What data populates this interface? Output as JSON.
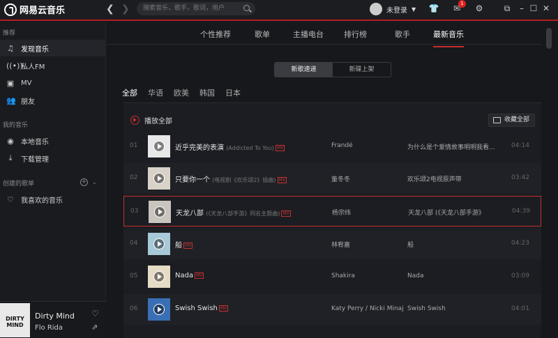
{
  "app": {
    "title": "网易云音乐"
  },
  "search": {
    "placeholder": "搜索音乐，歌手，歌词，用户"
  },
  "user": {
    "label": "未登录",
    "notifications": "1"
  },
  "sidebar": {
    "sections": [
      "推荐",
      "我的音乐",
      "创建的歌单"
    ],
    "items": [
      {
        "label": "发现音乐"
      },
      {
        "label": "私人FM"
      },
      {
        "label": "MV"
      },
      {
        "label": "朋友"
      },
      {
        "label": "本地音乐"
      },
      {
        "label": "下载管理"
      },
      {
        "label": "我喜欢的音乐"
      }
    ]
  },
  "now_playing": {
    "cover_text": "DIRTY MIND",
    "title": "Dirty Mind",
    "artist": "Flo Rida"
  },
  "tabs": [
    "个性推荐",
    "歌单",
    "主播电台",
    "排行榜",
    "歌手",
    "最新音乐"
  ],
  "segment": [
    "新歌速递",
    "新碟上架"
  ],
  "regions": [
    "全部",
    "华语",
    "欧美",
    "韩国",
    "日本"
  ],
  "list": {
    "play_all": "播放全部",
    "collect_all": "收藏全部",
    "songs": [
      {
        "num": "01",
        "title": "近乎完美的表演",
        "sub": "(Addicted To You)",
        "artist": "Frandé",
        "album": "为什么是个爱情故事明明我看...",
        "dur": "04:14"
      },
      {
        "num": "02",
        "title": "只要你一个",
        "sub": "(电视剧《欢乐颂2》插曲)",
        "artist": "董冬冬",
        "album": "欢乐颂2电视原声带",
        "dur": "03:42"
      },
      {
        "num": "03",
        "title": "天龙八部",
        "sub": "(《天龙八部手游》同名主题曲)",
        "artist": "杨宗纬",
        "album": "天龙八部 (《天龙八部手游》",
        "dur": "04:39"
      },
      {
        "num": "04",
        "title": "船",
        "sub": "",
        "artist": "林宥嘉",
        "album": "船",
        "dur": "04:23"
      },
      {
        "num": "05",
        "title": "Nada",
        "sub": "",
        "artist": "Shakira",
        "album": "Nada",
        "dur": "03:09"
      },
      {
        "num": "06",
        "title": "Swish Swish",
        "sub": "",
        "artist": "Katy Perry / Nicki Minaj",
        "album": "Swish Swish",
        "dur": "04:01"
      }
    ]
  },
  "mv_badge": "MV"
}
